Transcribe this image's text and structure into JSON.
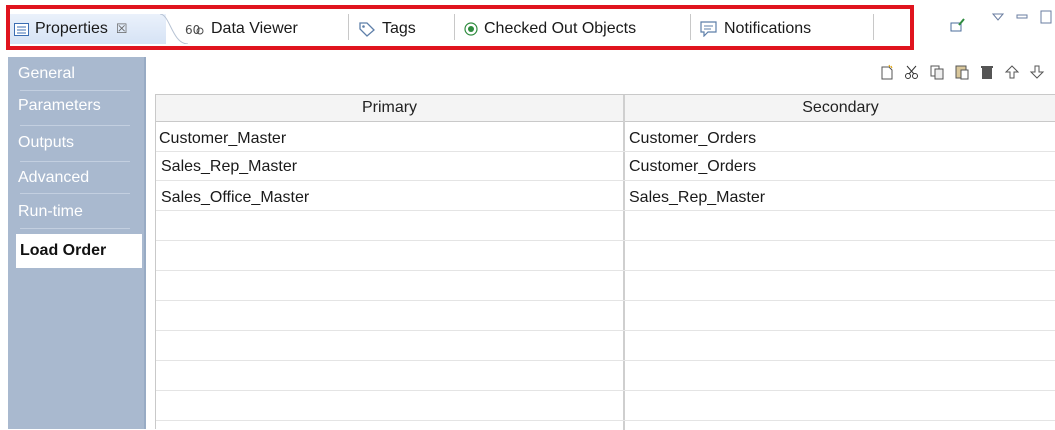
{
  "tabs": [
    {
      "label": "Properties",
      "icon": "properties-icon",
      "close": "☒"
    },
    {
      "label": "Data Viewer",
      "icon": "data-viewer-icon"
    },
    {
      "label": "Tags",
      "icon": "tag-icon"
    },
    {
      "label": "Checked Out Objects",
      "icon": "checked-out-icon"
    },
    {
      "label": "Notifications",
      "icon": "notifications-icon"
    }
  ],
  "view_controls": [
    "pin-icon",
    "view-menu-icon",
    "minimize-icon",
    "maximize-icon"
  ],
  "sidebar": {
    "items": [
      {
        "label": "General"
      },
      {
        "label": "Parameters"
      },
      {
        "label": "Outputs"
      },
      {
        "label": "Advanced"
      },
      {
        "label": "Run-time"
      },
      {
        "label": "Load Order"
      }
    ],
    "selected": "Load Order"
  },
  "toolbar": [
    "new-icon",
    "cut-icon",
    "copy-icon",
    "paste-icon",
    "delete-icon",
    "move-up-icon",
    "move-down-icon"
  ],
  "table": {
    "columns": [
      "Primary",
      "Secondary"
    ],
    "rows": [
      [
        "Customer_Master",
        "Customer_Orders"
      ],
      [
        "Sales_Rep_Master",
        "Customer_Orders"
      ],
      [
        "Sales_Office_Master",
        "Sales_Rep_Master"
      ]
    ]
  },
  "colors": {
    "highlight": "#e0141e",
    "sidebar_bg": "#a9b9cf",
    "active_tab": "#dbe6f6"
  }
}
